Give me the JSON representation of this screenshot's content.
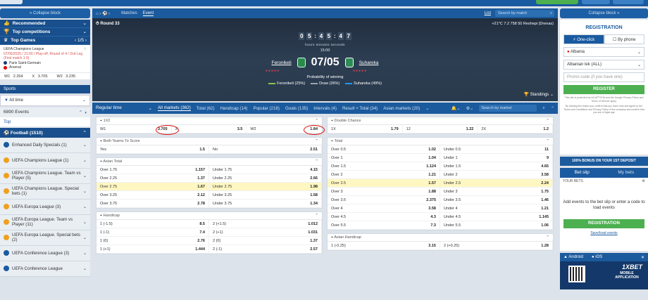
{
  "left": {
    "collapse": "« Collapse block",
    "recommended": "Recommended",
    "top_competitions": "Top competitions",
    "top_games": "Top Games",
    "top_games_pager": "1/5",
    "ucl_title": "UEFA Champions League",
    "ucl_info": "07/05/2025 / 21:00 / Play-off. Round of 4 / 2nd Leg (First match 1:0)",
    "team1": "Paris Saint-Germain",
    "team2": "Arsenal",
    "odds": [
      {
        "k": "W1",
        "v": "2.264"
      },
      {
        "k": "X",
        "v": "3.705"
      },
      {
        "k": "W2",
        "v": "3.235"
      }
    ],
    "sports": "Sports",
    "all_time": "All time",
    "events": "6890 Events",
    "top": "Top",
    "football": "Football (1510)",
    "comps": [
      "Enhanced Daily Specials (1)",
      "UEFA Champions League (1)",
      "UEFA Champions League. Team vs Player (5)",
      "UEFA Champions League. Special bets (1)",
      "UEFA Europa League (3)",
      "UEFA Europa League. Team vs Player (11)",
      "UEFA Europa League. Special bets (2)",
      "UEFA Conference League (3)",
      "UEFA Conference League"
    ]
  },
  "hero": {
    "nav_matches": "Matches",
    "nav_event": "Event",
    "list": "List",
    "search_placeholder": "Search by match",
    "round": "Round 33",
    "weather": "+21°C  7.2  758  50  Reshepi (Drenas)",
    "timer": [
      "0",
      "5",
      "4",
      "5",
      "4",
      "7"
    ],
    "labels": "hours   minutes   seconds",
    "kickoff": "15:00",
    "home": "Feronikeli",
    "away": "Suhareka",
    "date": "07/05",
    "probability": "Probability of winning",
    "leg_home": "Feronikeli (25%)",
    "leg_draw": "Draw (26%)",
    "leg_away": "Suhareka (49%)",
    "standings": "Standings"
  },
  "tabs": {
    "regular": "Regular time",
    "items": [
      "All markets (362)",
      "Total (62)",
      "Handicap (14)",
      "Popular (218)",
      "Goals (135)",
      "Intervals (4)",
      "Result + Total (34)",
      "Asian markets (20)"
    ],
    "search_market": "Search by market"
  },
  "markets": {
    "x12": {
      "title": "1X2",
      "cells": [
        [
          "W1",
          "3.705"
        ],
        [
          "X",
          "3.5"
        ],
        [
          "W2",
          "1.84"
        ]
      ]
    },
    "btts": {
      "title": "Both Teams To Score",
      "cells": [
        [
          "Yes",
          "1.5"
        ],
        [
          "No",
          "2.51"
        ]
      ]
    },
    "asian_total": {
      "title": "Asian Total",
      "rows": [
        [
          [
            "Over 1.75",
            "1.157"
          ],
          [
            "Under 1.75",
            "4.15"
          ]
        ],
        [
          [
            "Over 2.25",
            "1.37"
          ],
          [
            "Under 2.25",
            "2.66"
          ]
        ],
        [
          [
            "Over 2.75",
            "1.67"
          ],
          [
            "Under 2.75",
            "1.98"
          ]
        ],
        [
          [
            "Over 3.25",
            "2.12"
          ],
          [
            "Under 3.25",
            "1.58"
          ]
        ],
        [
          [
            "Over 3.75",
            "2.78"
          ],
          [
            "Under 3.75",
            "1.34"
          ]
        ]
      ]
    },
    "handicap": {
      "title": "Handicap",
      "rows": [
        [
          [
            "1 (-1.5)",
            "8.5"
          ],
          [
            "2 (+1.5)",
            "1.012"
          ]
        ],
        [
          [
            "1 (-1)",
            "7.4"
          ],
          [
            "2 (+1)",
            "1.031"
          ]
        ],
        [
          [
            "1 (0)",
            "2.76"
          ],
          [
            "2 (0)",
            "1.37"
          ]
        ],
        [
          [
            "1 (+1)",
            "1.444"
          ],
          [
            "2 (-1)",
            "2.57"
          ]
        ]
      ]
    },
    "double_chance": {
      "title": "Double Chance",
      "cells": [
        [
          "1X",
          "1.79"
        ],
        [
          "12",
          "1.22"
        ],
        [
          "2X",
          "1.2"
        ]
      ]
    },
    "total": {
      "title": "Total",
      "rows": [
        [
          [
            "Over 0.5",
            "1.02"
          ],
          [
            "Under 0.5",
            "11"
          ]
        ],
        [
          [
            "Over 1",
            "1.04"
          ],
          [
            "Under 1",
            "9"
          ]
        ],
        [
          [
            "Over 1.5",
            "1.124"
          ],
          [
            "Under 1.5",
            "4.65"
          ]
        ],
        [
          [
            "Over 2",
            "1.21"
          ],
          [
            "Under 2",
            "3.58"
          ]
        ],
        [
          [
            "Over 2.5",
            "1.57"
          ],
          [
            "Under 2.5",
            "2.24"
          ]
        ],
        [
          [
            "Over 3",
            "1.88"
          ],
          [
            "Under 3",
            "1.75"
          ]
        ],
        [
          [
            "Over 3.5",
            "2.375"
          ],
          [
            "Under 3.5",
            "1.46"
          ]
        ],
        [
          [
            "Over 4",
            "3.58"
          ],
          [
            "Under 4",
            "1.21"
          ]
        ],
        [
          [
            "Over 4.5",
            "4.3"
          ],
          [
            "Under 4.5",
            "1.145"
          ]
        ],
        [
          [
            "Over 5.5",
            "7.3"
          ],
          [
            "Under 5.5",
            "1.06"
          ]
        ]
      ]
    },
    "asian_handicap": {
      "title": "Asian Handicap",
      "rows": [
        [
          [
            "1 (-0.25)",
            "3.15"
          ],
          [
            "2 (+0.25)",
            "1.28"
          ]
        ]
      ]
    }
  },
  "right": {
    "collapse": "Collapse block »",
    "registration": "REGISTRATION",
    "one_click": "One-click",
    "by_phone": "By phone",
    "country": "Albania",
    "currency": "Albanian lek (ALL)",
    "promo_placeholder": "Promo code (if you have one)",
    "register": "REGISTER",
    "recaptcha": "This site is protected by reCAPTCHA and the Google Privacy Policy and Terms of Service apply.",
    "terms": "By clicking this button you confirm that you have read and agree to the Terms and Conditions and Privacy Policy of the company and confirm that you are of legal age",
    "bonus": "100% BONUS ON YOUR 1ST DEPOSIT",
    "bet_slip": "Bet slip",
    "my_bets": "My bets",
    "your_bets": "YOUR BETS",
    "add_events": "Add events to the bet slip or enter a code to load events",
    "registration_btn": "REGISTRATION",
    "save_load": "Save/load events",
    "android": "Android",
    "ios": "iOS",
    "brand": "1XBET",
    "mobile_app": "MOBILE APPLICATION"
  },
  "colors": {
    "primary": "#1a5aa0",
    "accent_green": "#4caf50",
    "highlight": "#fff7c2",
    "draw_line": "#9aa6b2",
    "home_line": "#8bc34a",
    "away_line": "#2196f3"
  }
}
